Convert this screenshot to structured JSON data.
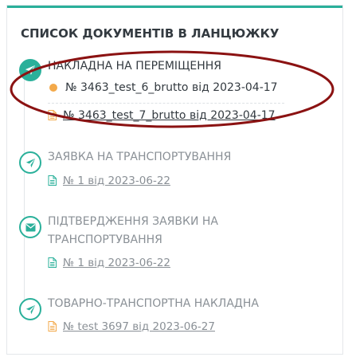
{
  "panel": {
    "title": "СПИСОК ДОКУМЕНТІВ В ЛАНЦЮЖКУ"
  },
  "steps": [
    {
      "title": "НАКЛАДНА НА ПЕРЕМІЩЕННЯ",
      "icon": "paper-plane-icon",
      "state": "active",
      "docs": [
        {
          "label": "№ 3463_test_6_brutto від 2023-04-17",
          "marker": "current-dot"
        },
        {
          "label": "№ 3463_test_7_brutto від 2023-04-17",
          "marker": "document-icon"
        }
      ]
    },
    {
      "title": "ЗАЯВКА НА ТРАНСПОРТУВАННЯ",
      "icon": "paper-plane-icon",
      "state": "inactive",
      "docs": [
        {
          "label": "№ 1 від 2023-06-22",
          "marker": "document-icon"
        }
      ]
    },
    {
      "title_line1": "ПІДТВЕРДЖЕННЯ ЗАЯВКИ НА",
      "title_line2": "ТРАНСПОРТУВАННЯ",
      "icon": "envelope-icon",
      "state": "inactive",
      "docs": [
        {
          "label": "№ 1 від 2023-06-22",
          "marker": "document-icon"
        }
      ]
    },
    {
      "title": "ТОВАРНО-ТРАНСПОРТНА НАКЛАДНА",
      "icon": "paper-plane-icon",
      "state": "inactive",
      "docs": [
        {
          "label": "№ test 3697 від 2023-06-27",
          "marker": "document-icon"
        }
      ]
    }
  ],
  "colors": {
    "accent": "#2ab09a",
    "doc_green": "#2ab09a",
    "doc_orange": "#f3a94a",
    "annotation": "#8b1212"
  }
}
